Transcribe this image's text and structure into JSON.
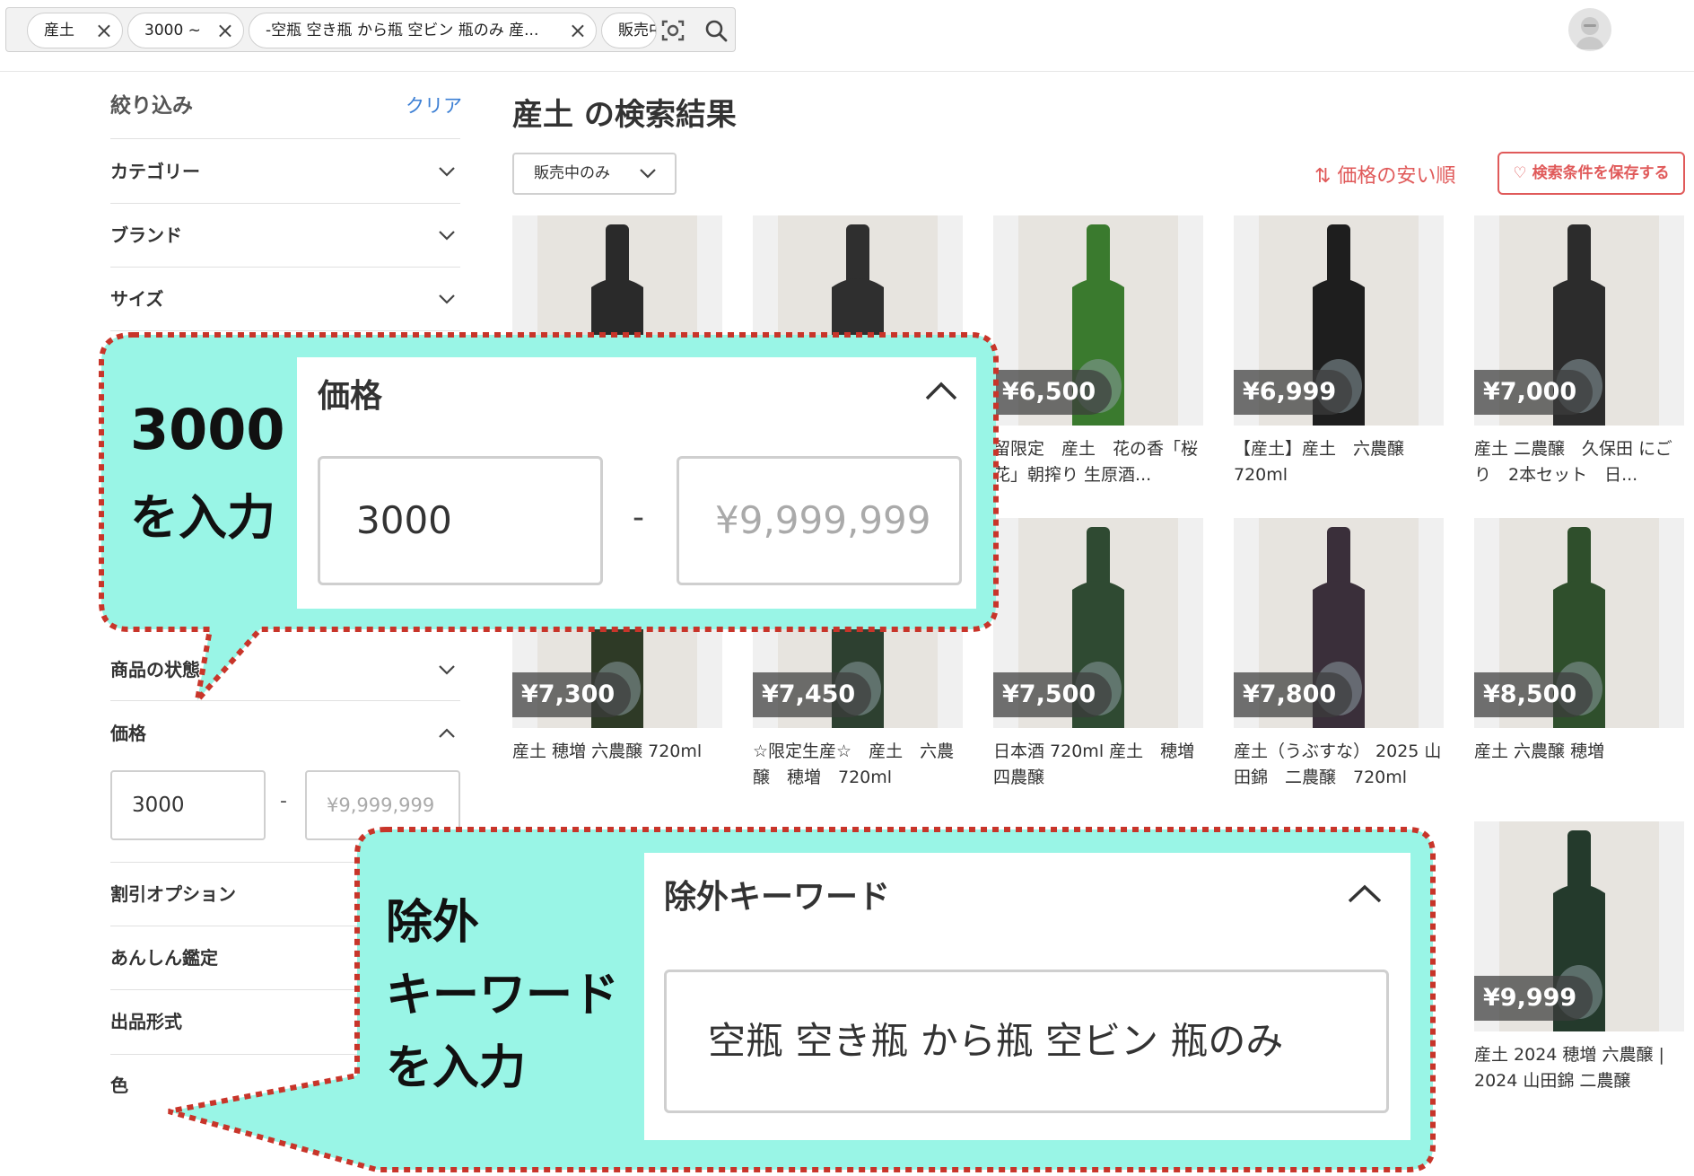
{
  "header": {
    "chips": [
      {
        "label": "産土"
      },
      {
        "label": "3000 ~"
      },
      {
        "label": "-空瓶 空き瓶 から瓶 空ビン 瓶のみ 産..."
      },
      {
        "label": "販売中"
      }
    ],
    "close_glyph": "×",
    "icons": [
      "image-search-icon",
      "search-icon",
      "avatar-icon"
    ]
  },
  "sidebar": {
    "title": "絞り込み",
    "clear": "クリア",
    "filters": [
      {
        "label": "カテゴリー"
      },
      {
        "label": "ブランド"
      },
      {
        "label": "サイズ"
      },
      {
        "label": "商品の状態"
      }
    ],
    "price": {
      "label": "価格",
      "min_value": "3000",
      "max_placeholder": "¥9,999,999",
      "dash": "-"
    },
    "more_filters": [
      {
        "label": "割引オプション"
      },
      {
        "label": "あんしん鑑定"
      },
      {
        "label": "出品形式"
      },
      {
        "label": "色"
      }
    ]
  },
  "results": {
    "title": "産土 の検索結果",
    "status_filter": "販売中のみ",
    "sort_label": "⇅ 価格の安い順",
    "save_label": "♡ 検索条件を保存する",
    "items": [
      {
        "price": "",
        "name": ""
      },
      {
        "price": "",
        "name": ""
      },
      {
        "price": "¥6,500",
        "name": "留限定　産土　花の香「桜花」朝搾り 生原酒..."
      },
      {
        "price": "¥6,999",
        "name": "【産土】産土　六農醸 720ml"
      },
      {
        "price": "¥7,000",
        "name": "産土 二農醸　久保田 にごり　2本セット　日..."
      },
      {
        "price": "¥7,300",
        "name": "産土 穂増 六農醸 720ml"
      },
      {
        "price": "¥7,450",
        "name": "☆限定生産☆　産土　六農醸　穂増　720ml"
      },
      {
        "price": "¥7,500",
        "name": "日本酒 720ml 産土　穂増 四農醸"
      },
      {
        "price": "¥7,800",
        "name": "産土（うぶすな） 2025 山田錦　二農醸　720ml"
      },
      {
        "price": "¥8,500",
        "name": "産土 六農醸 穂増"
      },
      {
        "price": "¥9,999",
        "name": "産土 2024 穂増 六農醸 | 2024 山田錦 二農醸"
      }
    ]
  },
  "callouts": {
    "price": {
      "text_line1": "3000",
      "text_line2": "を入力",
      "panel_title": "価格",
      "min_value": "3000",
      "dash": "-",
      "max_placeholder": "¥9,999,999"
    },
    "exclude": {
      "text_line1": "除外",
      "text_line2": "キーワード",
      "text_line3": "を入力",
      "panel_title": "除外キーワード",
      "value": "空瓶 空き瓶 から瓶 空ビン 瓶のみ"
    },
    "fill_color": "#99f5e6",
    "border_color": "#c8352a"
  }
}
